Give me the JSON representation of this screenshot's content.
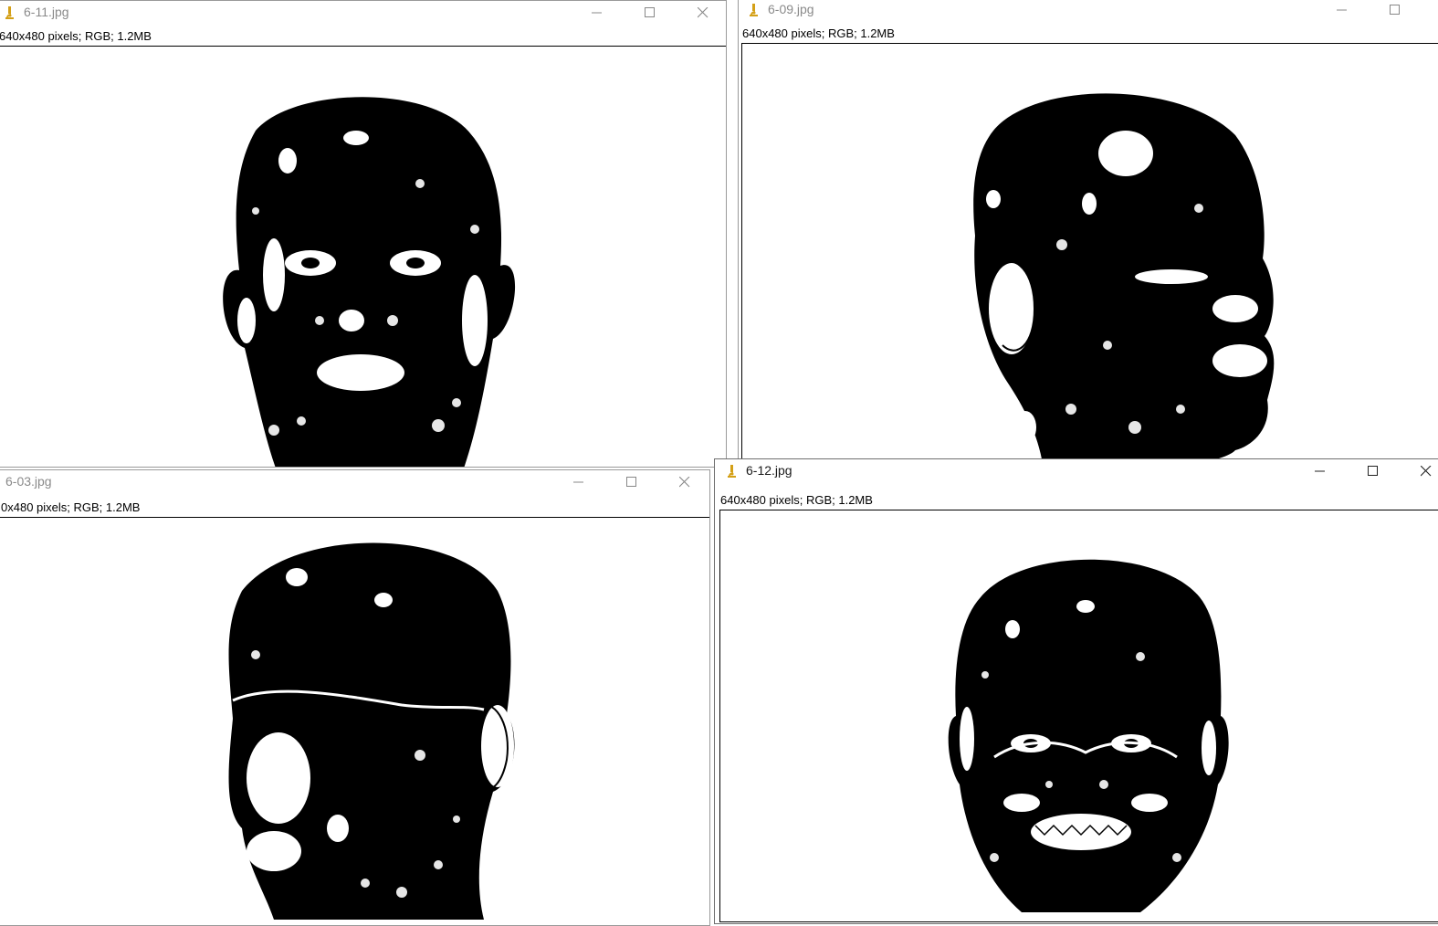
{
  "windows": [
    {
      "title": "6-11.jpg",
      "info": "640x480 pixels; RGB; 1.2MB",
      "image": "binary-threshold-face-frontal"
    },
    {
      "title": "6-09.jpg",
      "info": "640x480 pixels; RGB; 1.2MB",
      "image": "binary-threshold-face-profile"
    },
    {
      "title": "6-03.jpg",
      "info": "0x480 pixels; RGB; 1.2MB",
      "image": "binary-threshold-face-three-quarter"
    },
    {
      "title": "6-12.jpg",
      "info": "640x480 pixels; RGB; 1.2MB",
      "image": "binary-threshold-face-smiling"
    }
  ],
  "icons": {
    "app": "microscope-icon",
    "minimize": "minimize-icon",
    "maximize": "maximize-icon",
    "close": "close-icon"
  },
  "colors": {
    "app_icon": "#d4a017",
    "inactive_title": "#8a8a8a",
    "active_title": "#1a1a1a"
  }
}
